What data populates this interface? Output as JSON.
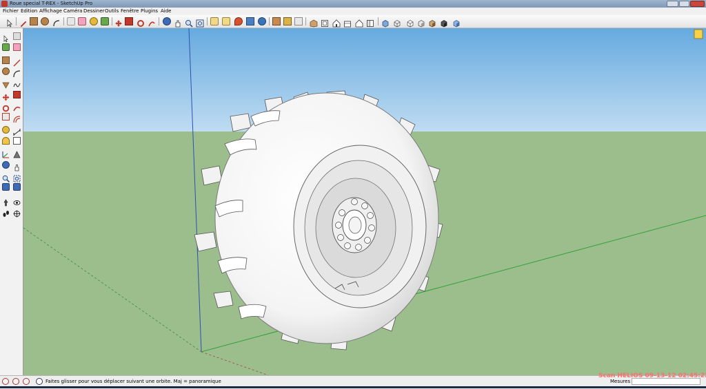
{
  "window": {
    "title": "Roue special T-REX - SketchUp Pro"
  },
  "menu": {
    "items": [
      "Fichier",
      "Edition",
      "Affichage",
      "Caméra",
      "Dessiner",
      "Outils",
      "Fenêtre",
      "Plugins",
      "Aide"
    ]
  },
  "toolbar": {
    "tools": [
      "select",
      "pencil",
      "rectangle",
      "circle",
      "arc",
      "eraser",
      "paint-bucket",
      "tape-measure",
      "push-pull",
      "move",
      "rotate",
      "follow-me",
      "orbit",
      "pan",
      "zoom",
      "zoom-extents",
      "previous-view",
      "next-view",
      "add-location",
      "get-models",
      "share-model",
      "components",
      "styles",
      "layers",
      "iso-view",
      "top-view",
      "front-view",
      "right-view",
      "back-view",
      "left-view",
      "xray",
      "wireframe",
      "hidden-line",
      "shaded",
      "shaded-textures",
      "monochrome"
    ]
  },
  "left_toolbar": {
    "tools": [
      "select",
      "make-component",
      "paint-bucket",
      "eraser",
      "rectangle",
      "line",
      "circle",
      "arc",
      "polygon",
      "freehand",
      "move",
      "push-pull",
      "rotate",
      "follow-me",
      "scale",
      "offset",
      "tape-measure",
      "dimension",
      "protractor",
      "text",
      "axes",
      "3d-text",
      "orbit",
      "pan",
      "zoom",
      "zoom-window",
      "zoom-extents",
      "previous",
      "position-camera",
      "look-around",
      "walk",
      "section-plane"
    ]
  },
  "status": {
    "message": "Faites glisser pour vous déplacer suivant une orbite.  Maj = panoramique",
    "measure_label": "Mesures",
    "measure_value": ""
  },
  "watermark": {
    "text": "Scan HELIOS 09-13-12 02:45:22"
  },
  "colors": {
    "sky_top": "#66aadf",
    "sky_horizon": "#bfdcf2",
    "ground": "#9cbd8c",
    "axis_red": "#c84040",
    "axis_green": "#2fa23a",
    "axis_blue": "#2e4fb0"
  }
}
